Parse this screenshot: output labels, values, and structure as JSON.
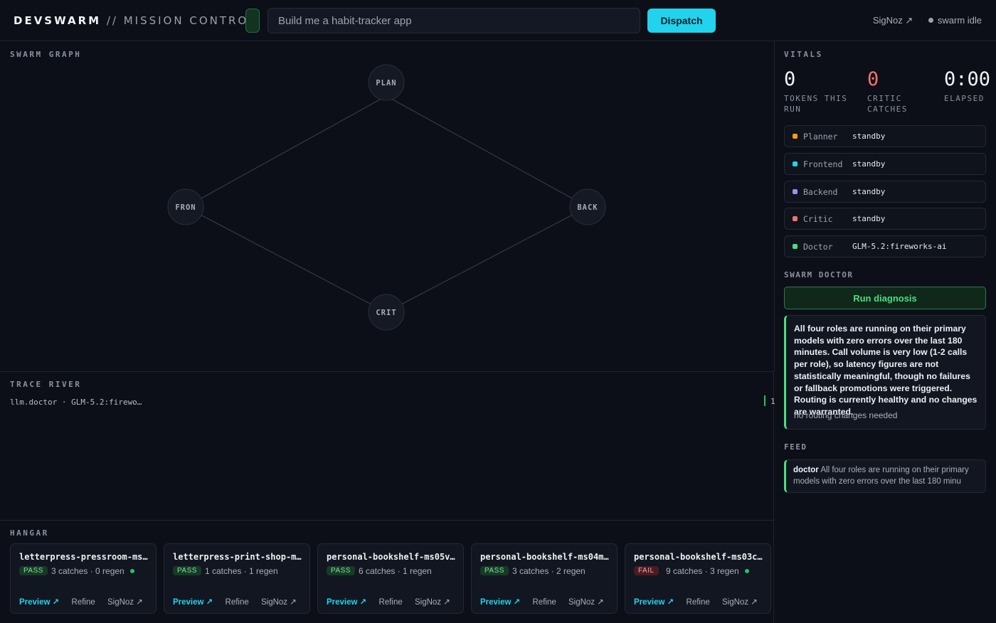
{
  "header": {
    "brand_strong": "DEVSWARM",
    "brand_rest": " // MISSION CONTROL",
    "prompt_placeholder": "Build me a habit-tracker app",
    "dispatch_label": "Dispatch",
    "signoz_link": "SigNoz ↗",
    "status_text": "swarm idle"
  },
  "graph": {
    "label": "SWARM GRAPH",
    "nodes": [
      "PLAN",
      "FRON",
      "BACK",
      "CRIT"
    ]
  },
  "trace": {
    "label": "TRACE RIVER",
    "line": "llm.doctor · GLM-5.2:firewo…",
    "count": "1"
  },
  "hangar": {
    "label": "HANGAR",
    "cards": [
      {
        "title": "letterpress-pressroom-ms0…",
        "status": "PASS",
        "meta": "3 catches · 0 regen",
        "live": true,
        "preview": "Preview ↗",
        "refine": "Refine",
        "signoz": "SigNoz ↗"
      },
      {
        "title": "letterpress-print-shop-ms…",
        "status": "PASS",
        "meta": "1 catches · 1 regen",
        "live": false,
        "preview": "Preview ↗",
        "refine": "Refine",
        "signoz": "SigNoz ↗"
      },
      {
        "title": "personal-bookshelf-ms05vf…",
        "status": "PASS",
        "meta": "6 catches · 1 regen",
        "live": false,
        "preview": "Preview ↗",
        "refine": "Refine",
        "signoz": "SigNoz ↗"
      },
      {
        "title": "personal-bookshelf-ms04mc…",
        "status": "PASS",
        "meta": "3 catches · 2 regen",
        "live": false,
        "preview": "Preview ↗",
        "refine": "Refine",
        "signoz": "SigNoz ↗"
      },
      {
        "title": "personal-bookshelf-ms03c8…",
        "status": "FAIL",
        "meta": "9 catches · 3 regen",
        "live": true,
        "preview": "Preview ↗",
        "refine": "Refine",
        "signoz": "SigNoz ↗"
      }
    ]
  },
  "vitals": {
    "label": "VITALS",
    "tokens_value": "0",
    "tokens_label_1": "TOKENS THIS",
    "tokens_label_2": "RUN",
    "critic_value": "0",
    "critic_label_1": "CRITIC",
    "critic_label_2": "CATCHES",
    "elapsed_value": "0:00",
    "elapsed_label": "ELAPSED"
  },
  "roles": [
    {
      "name": "Planner",
      "status": "standby",
      "color": "#f59e0b"
    },
    {
      "name": "Frontend",
      "status": "standby",
      "color": "#22d3ee"
    },
    {
      "name": "Backend",
      "status": "standby",
      "color": "#a78bfa"
    },
    {
      "name": "Critic",
      "status": "standby",
      "color": "#f87171"
    },
    {
      "name": "Doctor",
      "status": "GLM-5.2:fireworks-ai",
      "color": "#4ade80"
    }
  ],
  "doctor": {
    "label": "SWARM DOCTOR",
    "button_label": "Run diagnosis",
    "diagnosis": "All four roles are running on their primary models with zero errors over the last 180 minutes. Call volume is very low (1-2 calls per role), so latency figures are not statistically meaningful, though no failures or fallback promotions were triggered. Routing is currently healthy and no changes are warranted.",
    "verdict": "no routing changes needed"
  },
  "feed": {
    "label": "FEED",
    "author": "doctor",
    "text": " All four roles are running on their primary models with zero errors over the last 180 minu"
  },
  "colors": {
    "accent": "#22d3ee",
    "ok": "#4ade80",
    "critic": "#f87171"
  }
}
